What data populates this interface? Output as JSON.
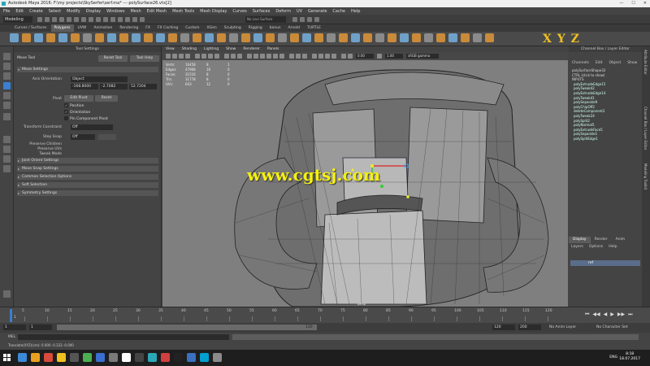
{
  "titlebar": {
    "text": "Autodesk Maya 2016: F:\\my projects\\SkySerfer\\serf.ma*  ---  polySurface26.vtx[2]",
    "minimize": "—",
    "maximize": "☐",
    "close": "✕"
  },
  "menubar": {
    "items": [
      "File",
      "Edit",
      "Create",
      "Select",
      "Modify",
      "Display",
      "Windows",
      "Mesh",
      "Edit Mesh",
      "Mesh Tools",
      "Mesh Display",
      "Curves",
      "Surfaces",
      "Deform",
      "UV",
      "Generate",
      "Cache",
      "Help"
    ],
    "live_surface": "No Live Surface",
    "mode": "Modeling"
  },
  "shelf": {
    "tabs": [
      "Curves / Surfaces",
      "Polygons",
      "UVW",
      "Animation",
      "Rendering",
      "FX",
      "FX Caching",
      "Custom",
      "XGen",
      "Sculpting",
      "Rigging",
      "bonus",
      "Arnold",
      "TURTLE"
    ],
    "active_tab": "Polygons",
    "axis_letters": "X Y Z"
  },
  "toolsettings": {
    "header": "Tool Settings",
    "title": "Move Tool",
    "reset_button": "Reset Tool",
    "help_button": "Tool Help",
    "move_settings": "Move Settings",
    "axis_orientation_label": "Axis Orientation",
    "axis_orientation_value": "Object",
    "coords": [
      "-168.8000",
      "-2.7082",
      "52.7204"
    ],
    "pivot_label": "Pivot",
    "edit_pivot_button": "Edit Pivot",
    "reset_pivot_button": "Reset",
    "check_position": "Position",
    "check_orientation": "Orientation",
    "check_pin": "Pin Component Pivot",
    "transform_constraint_label": "Transform Constraint",
    "transform_constraint_value": "Off",
    "step_snap_label": "Step Snap",
    "step_snap_value": "Off",
    "preserve_children": "Preserve Children",
    "preserve_uvs": "Preserve UVs",
    "tweak_mode": "Tweak Mode",
    "sections": [
      "Joint Orient Settings",
      "Move Snap Settings",
      "Common Selection Options",
      "Soft Selection",
      "Symmetry Settings"
    ]
  },
  "viewport": {
    "menu": [
      "View",
      "Shading",
      "Lighting",
      "Show",
      "Renderer",
      "Panels"
    ],
    "field_value": "0.00",
    "field_value2": "1.00",
    "colorspace": "sRGB gamma",
    "hud": [
      [
        "Verts:",
        "16458",
        "8",
        "1"
      ],
      [
        "Edges:",
        "47968",
        "16",
        "0"
      ],
      [
        "Faces:",
        "31516",
        "8",
        "0"
      ],
      [
        "Tris:",
        "31778",
        "8",
        "0"
      ],
      [
        "UVs:",
        "643",
        "12",
        "0"
      ]
    ],
    "watermark": "www.cgtsj.com",
    "camera_label": "persp"
  },
  "channelbox": {
    "header": "Channel Box / Layer Editor",
    "menu": [
      "Channels",
      "Edit",
      "Object",
      "Show"
    ],
    "shape": "polySurfaceShape32",
    "hint": "CTRL (click to show)",
    "inputs_label": "INPUTS",
    "inputs": [
      "polyExtrudeEdge15",
      "polyTweak42",
      "polyExtrudeEdge14",
      "polyTweak41",
      "polySeparate9",
      "polyChipOff2",
      "deleteComponent2",
      "polyTweak24",
      "polySplit2",
      "polyNormal5",
      "polyExtrudeFace5",
      "polySeparate1",
      "polySplitEdge1"
    ],
    "layer_tabs": [
      "Display",
      "Render",
      "Anim"
    ],
    "active_layer_tab": "Display",
    "layer_menu": [
      "Layers",
      "Options",
      "Help"
    ],
    "layer_name": "ref",
    "side_labels": [
      "Attribute Editor",
      "Channel Box / Layer Editor",
      "Modeling Toolkit"
    ]
  },
  "timeslider": {
    "ticks": [
      "5",
      "10",
      "15",
      "20",
      "25",
      "30",
      "35",
      "40",
      "45",
      "50",
      "55",
      "60",
      "65",
      "70",
      "75",
      "80",
      "85",
      "90",
      "95",
      "100",
      "105",
      "110",
      "115",
      "120"
    ],
    "current_frame": "1",
    "controls": [
      "⏮",
      "◀◀",
      "◀",
      "▶",
      "▶▶",
      "⏭"
    ]
  },
  "rangeslider": {
    "start": "1",
    "start2": "1",
    "range_end": "120",
    "end": "120",
    "end2": "200",
    "anim_layer": "No Anim Layer",
    "character": "No Character Set"
  },
  "cmdline": {
    "mel": "MEL"
  },
  "statusstrip": {
    "text": "Translate(XYZ)(cm):  0.000   -0.333   -0.000"
  },
  "taskbar": {
    "time": "8:18",
    "date": "18.07.2017",
    "lang": "ENG",
    "icon_colors": [
      "#3b8ad8",
      "#e8a020",
      "#d84a3a",
      "#f0c020",
      "#555555",
      "#4caf50",
      "#3a6fd0",
      "#7a7a7a",
      "#ffffff",
      "#444444",
      "#2aa8b8",
      "#d04040",
      "#222222",
      "#3a70c0",
      "#00a0d0",
      "#8a8a8a"
    ]
  }
}
